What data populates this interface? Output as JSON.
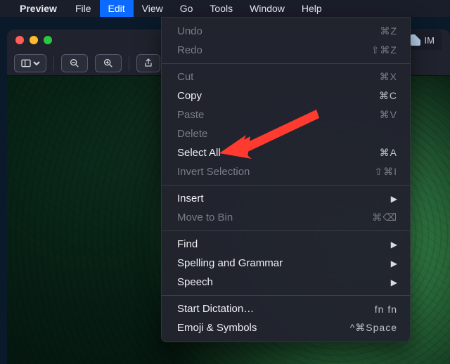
{
  "menubar": {
    "app_name": "Preview",
    "items": [
      "File",
      "Edit",
      "View",
      "Go",
      "Tools",
      "Window",
      "Help"
    ],
    "open_index": 1
  },
  "window": {
    "tab_label": "IM",
    "toolbar": {
      "sidebar_tooltip": "Sidebar",
      "zoom_out": "−",
      "zoom_in": "+",
      "share_tooltip": "Share"
    }
  },
  "edit_menu": [
    {
      "label": "Undo",
      "shortcut": "⌘Z",
      "enabled": false
    },
    {
      "label": "Redo",
      "shortcut": "⇧⌘Z",
      "enabled": false
    },
    {
      "separator": true
    },
    {
      "label": "Cut",
      "shortcut": "⌘X",
      "enabled": false
    },
    {
      "label": "Copy",
      "shortcut": "⌘C",
      "enabled": true
    },
    {
      "label": "Paste",
      "shortcut": "⌘V",
      "enabled": false
    },
    {
      "label": "Delete",
      "shortcut": "",
      "enabled": false
    },
    {
      "label": "Select All",
      "shortcut": "⌘A",
      "enabled": true
    },
    {
      "label": "Invert Selection",
      "shortcut": "⇧⌘I",
      "enabled": false
    },
    {
      "separator": true
    },
    {
      "label": "Insert",
      "shortcut": "",
      "enabled": true,
      "submenu": true
    },
    {
      "label": "Move to Bin",
      "shortcut": "⌘⌫",
      "enabled": false
    },
    {
      "separator": true
    },
    {
      "label": "Find",
      "shortcut": "",
      "enabled": true,
      "submenu": true
    },
    {
      "label": "Spelling and Grammar",
      "shortcut": "",
      "enabled": true,
      "submenu": true
    },
    {
      "label": "Speech",
      "shortcut": "",
      "enabled": true,
      "submenu": true
    },
    {
      "separator": true
    },
    {
      "label": "Start Dictation…",
      "shortcut": "fn fn",
      "enabled": true
    },
    {
      "label": "Emoji & Symbols",
      "shortcut": "^⌘Space",
      "enabled": true
    }
  ],
  "annotation": {
    "points_to": "Select All"
  }
}
